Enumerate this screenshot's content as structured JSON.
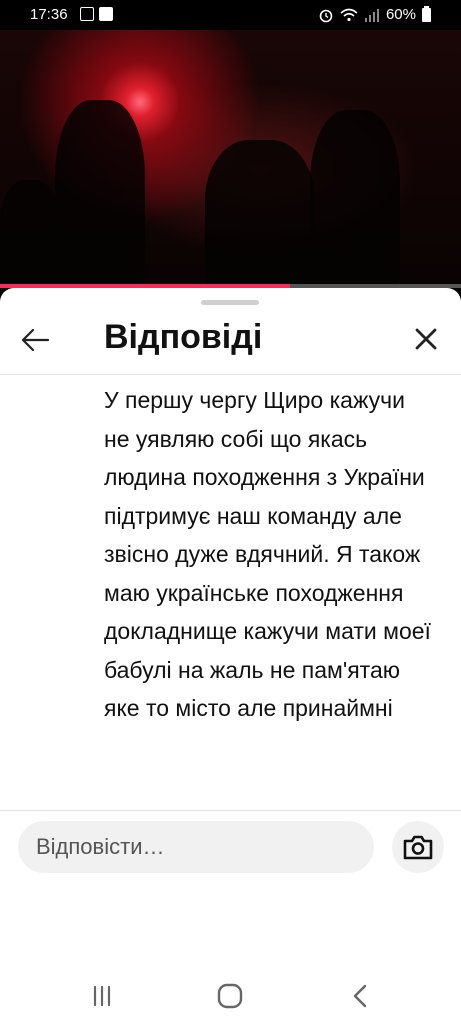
{
  "status_bar": {
    "time": "17:36",
    "battery": "60%",
    "icons": [
      "gallery-icon",
      "check-icon",
      "alarm-icon",
      "wifi-icon",
      "signal-icon",
      "battery-icon"
    ]
  },
  "video": {
    "progress": 0.63,
    "accent_color": "#ff2a55"
  },
  "sheet": {
    "title": "Відповіді",
    "back_icon": "arrow-left-icon",
    "close_icon": "close-icon"
  },
  "comment": {
    "text": "У першу чергу Щиро кажучи не уявляю собі що якась людина походження з України підтримує наш команду але звісно дуже вдячний. Я також маю українське походження докладнище кажучи мати моеї бабулі на жаль не пам'ятаю яке то місто але принаймні"
  },
  "reply": {
    "placeholder": "Відповісти…",
    "camera_icon": "camera-icon"
  },
  "nav": {
    "icons": [
      "recents-icon",
      "home-icon",
      "back-icon"
    ]
  }
}
